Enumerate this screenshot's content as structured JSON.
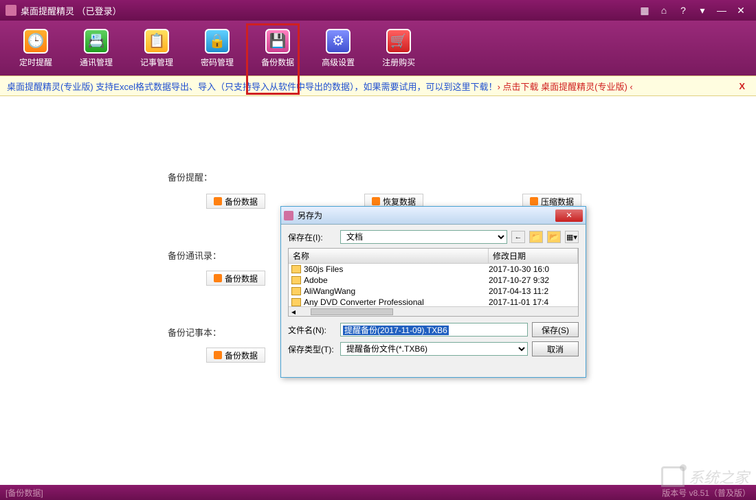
{
  "title": "桌面提醒精灵 （已登录）",
  "toolbar": [
    {
      "label": "定时提醒",
      "cls": "ti-orange"
    },
    {
      "label": "通讯管理",
      "cls": "ti-green"
    },
    {
      "label": "记事管理",
      "cls": "ti-yellow"
    },
    {
      "label": "密码管理",
      "cls": "ti-cyan"
    },
    {
      "label": "备份数据",
      "cls": "ti-pink"
    },
    {
      "label": "高级设置",
      "cls": "ti-blue"
    },
    {
      "label": "注册购买",
      "cls": "ti-red"
    }
  ],
  "marquee": {
    "part1": "桌面提醒精灵(专业版) 支持Excel格式数据导出、导入（只支持导入从软件中导出的数据），如果需要试用，可以到这里下载！ ",
    "part2": "› 点击下载 桌面提醒精灵(专业版) ‹",
    "close": "X"
  },
  "sections": {
    "s1": "备份提醒：",
    "s2": "备份通讯录：",
    "s3": "备份记事本：",
    "btn_backup": "备份数据",
    "btn_restore": "恢复数据",
    "btn_compress": "压缩数据"
  },
  "dialog": {
    "title": "另存为",
    "save_in": "保存在(I):",
    "location": "文档",
    "col_name": "名称",
    "col_date": "修改日期",
    "rows": [
      {
        "name": "360js Files",
        "date": "2017-10-30 16:0"
      },
      {
        "name": "Adobe",
        "date": "2017-10-27 9:32"
      },
      {
        "name": "AliWangWang",
        "date": "2017-04-13 11:2"
      },
      {
        "name": "Any DVD Converter Professional",
        "date": "2017-11-01 17:4"
      }
    ],
    "file_label": "文件名(N):",
    "file_value": "提醒备份(2017-11-09).TXB6",
    "type_label": "保存类型(T):",
    "type_value": "提醒备份文件(*.TXB6)",
    "save_btn": "保存(S)",
    "cancel_btn": "取消"
  },
  "status": {
    "left": "[备份数据]",
    "right": "版本号 v8.51（普及版）"
  },
  "watermark": "系统之家"
}
